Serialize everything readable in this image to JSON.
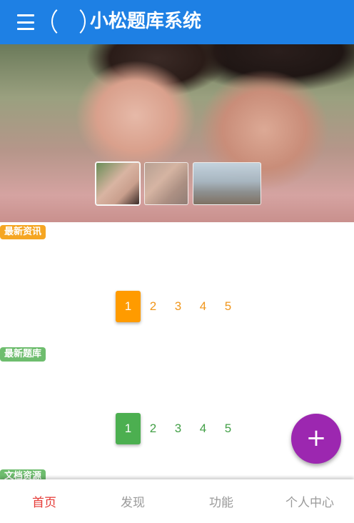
{
  "header": {
    "title": "小松题库系统",
    "menu_icon": "hamburger-menu-icon",
    "logo_icon": "logo-icon"
  },
  "banner": {
    "thumbnails": [
      "thumb-couple",
      "thumb-couple-2",
      "thumb-factory"
    ]
  },
  "sections": {
    "news": {
      "tag": "最新资讯",
      "pages": [
        "1",
        "2",
        "3",
        "4",
        "5"
      ],
      "active_page": "1",
      "accent": "#ff9b00"
    },
    "question_bank": {
      "tag": "最新题库",
      "pages": [
        "1",
        "2",
        "3",
        "4",
        "5"
      ],
      "active_page": "1",
      "accent": "#4caf50"
    },
    "documents": {
      "tag": "文档资源"
    }
  },
  "fab": {
    "label": "+",
    "color": "#9c27b0"
  },
  "bottom_nav": {
    "items": [
      {
        "label": "首页"
      },
      {
        "label": "发现"
      },
      {
        "label": "功能"
      },
      {
        "label": "个人中心"
      }
    ],
    "active_color": "#e53935"
  },
  "colors": {
    "header": "#1e80e4"
  }
}
